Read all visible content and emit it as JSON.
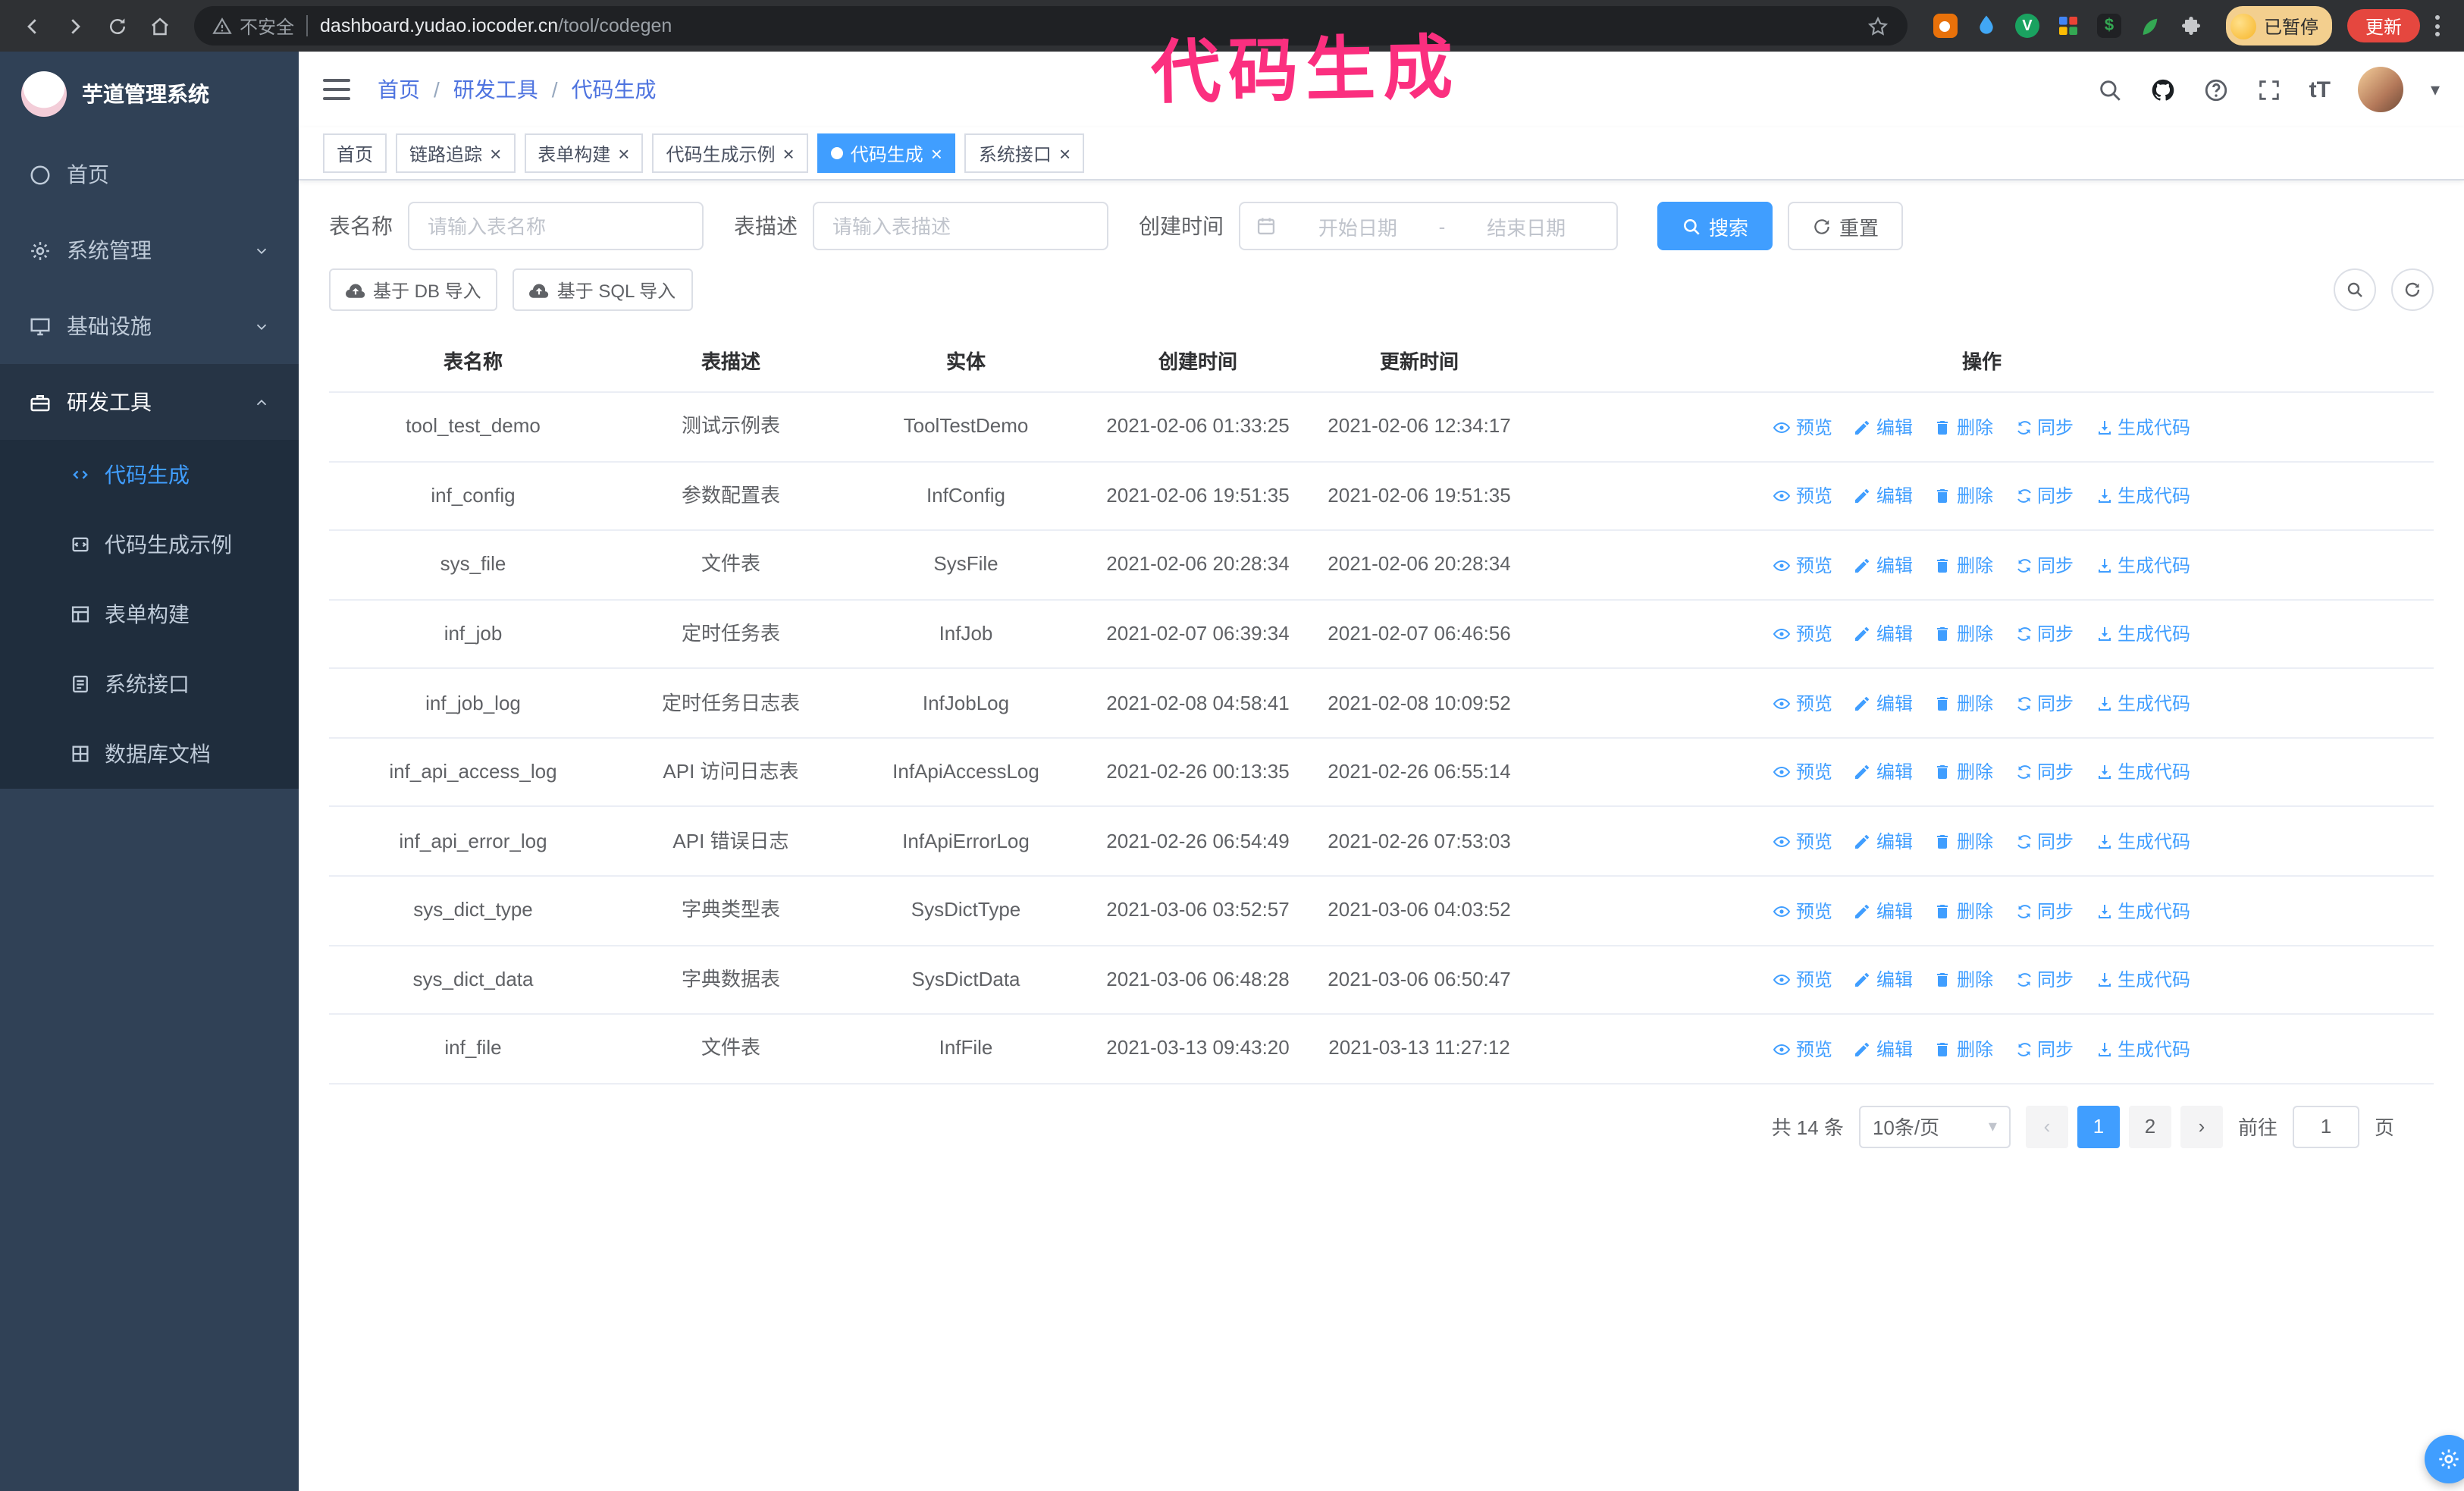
{
  "browser": {
    "security_label": "不安全",
    "url_host": "dashboard.yudao.iocoder.cn",
    "url_path": "/tool/codegen",
    "profile_badge": "已暂停",
    "update_button": "更新"
  },
  "annotation": {
    "text": "代码生成",
    "color": "#fb2f7f"
  },
  "glyphs": {
    "close": "×",
    "caret_down": "▾",
    "prev": "‹",
    "next": "›",
    "font_size": "tT",
    "date_dash": "-",
    "breadcrumb_separator": "/"
  },
  "sidebar": {
    "title": "芋道管理系统",
    "menu": [
      {
        "label": "首页",
        "icon": "dashboard-icon"
      },
      {
        "label": "系统管理",
        "icon": "gear-icon"
      },
      {
        "label": "基础设施",
        "icon": "monitor-icon"
      },
      {
        "label": "研发工具",
        "icon": "toolbox-icon"
      }
    ],
    "submenu": [
      {
        "label": "代码生成",
        "icon": "code-icon",
        "active": true
      },
      {
        "label": "代码生成示例",
        "icon": "example-icon",
        "active": false
      },
      {
        "label": "表单构建",
        "icon": "form-icon",
        "active": false
      },
      {
        "label": "系统接口",
        "icon": "api-icon",
        "active": false
      },
      {
        "label": "数据库文档",
        "icon": "database-icon",
        "active": false
      }
    ]
  },
  "header": {
    "breadcrumb": [
      "首页",
      "研发工具",
      "代码生成"
    ]
  },
  "tabs": [
    {
      "label": "首页",
      "closable": false,
      "active": false
    },
    {
      "label": "链路追踪",
      "closable": true,
      "active": false
    },
    {
      "label": "表单构建",
      "closable": true,
      "active": false
    },
    {
      "label": "代码生成示例",
      "closable": true,
      "active": false
    },
    {
      "label": "代码生成",
      "closable": true,
      "active": true
    },
    {
      "label": "系统接口",
      "closable": true,
      "active": false
    }
  ],
  "filters": {
    "table_name_label": "表名称",
    "table_name_placeholder": "请输入表名称",
    "table_desc_label": "表描述",
    "table_desc_placeholder": "请输入表描述",
    "create_time_label": "创建时间",
    "start_date_placeholder": "开始日期",
    "end_date_placeholder": "结束日期",
    "search_button": "搜索",
    "reset_button": "重置"
  },
  "toolbar": {
    "import_db_button": "基于 DB 导入",
    "import_sql_button": "基于 SQL 导入"
  },
  "table": {
    "columns": [
      "表名称",
      "表描述",
      "实体",
      "创建时间",
      "更新时间",
      "操作"
    ],
    "actions": [
      {
        "label": "预览",
        "name": "preview-link",
        "icon": "eye-icon"
      },
      {
        "label": "编辑",
        "name": "edit-link",
        "icon": "edit-icon"
      },
      {
        "label": "删除",
        "name": "delete-link",
        "icon": "delete-icon"
      },
      {
        "label": "同步",
        "name": "sync-link",
        "icon": "sync-icon"
      },
      {
        "label": "生成代码",
        "name": "generate-code-link",
        "icon": "download-icon"
      }
    ],
    "rows": [
      {
        "name": "tool_test_demo",
        "desc": "测试示例表",
        "entity": "ToolTestDemo",
        "created": "2021-02-06 01:33:25",
        "updated": "2021-02-06 12:34:17"
      },
      {
        "name": "inf_config",
        "desc": "参数配置表",
        "entity": "InfConfig",
        "created": "2021-02-06 19:51:35",
        "updated": "2021-02-06 19:51:35"
      },
      {
        "name": "sys_file",
        "desc": "文件表",
        "entity": "SysFile",
        "created": "2021-02-06 20:28:34",
        "updated": "2021-02-06 20:28:34"
      },
      {
        "name": "inf_job",
        "desc": "定时任务表",
        "entity": "InfJob",
        "created": "2021-02-07 06:39:34",
        "updated": "2021-02-07 06:46:56"
      },
      {
        "name": "inf_job_log",
        "desc": "定时任务日志表",
        "entity": "InfJobLog",
        "created": "2021-02-08 04:58:41",
        "updated": "2021-02-08 10:09:52"
      },
      {
        "name": "inf_api_access_log",
        "desc": "API 访问日志表",
        "entity": "InfApiAccessLog",
        "created": "2021-02-26 00:13:35",
        "updated": "2021-02-26 06:55:14"
      },
      {
        "name": "inf_api_error_log",
        "desc": "API 错误日志",
        "entity": "InfApiErrorLog",
        "created": "2021-02-26 06:54:49",
        "updated": "2021-02-26 07:53:03"
      },
      {
        "name": "sys_dict_type",
        "desc": "字典类型表",
        "entity": "SysDictType",
        "created": "2021-03-06 03:52:57",
        "updated": "2021-03-06 04:03:52"
      },
      {
        "name": "sys_dict_data",
        "desc": "字典数据表",
        "entity": "SysDictData",
        "created": "2021-03-06 06:48:28",
        "updated": "2021-03-06 06:50:47"
      },
      {
        "name": "inf_file",
        "desc": "文件表",
        "entity": "InfFile",
        "created": "2021-03-13 09:43:20",
        "updated": "2021-03-13 11:27:12"
      }
    ]
  },
  "pagination": {
    "total_label": "共 14 条",
    "page_size": "10条/页",
    "pages": [
      "1",
      "2"
    ],
    "active_page": "1",
    "goto_label": "前往",
    "goto_value": "1",
    "page_unit": "页"
  },
  "colors": {
    "accent": "#409EFF",
    "sidebar_bg": "#304156",
    "submenu_bg": "#1f2d3d",
    "update_button_bg": "#e5473f",
    "annotation": "#fb2f7f"
  }
}
